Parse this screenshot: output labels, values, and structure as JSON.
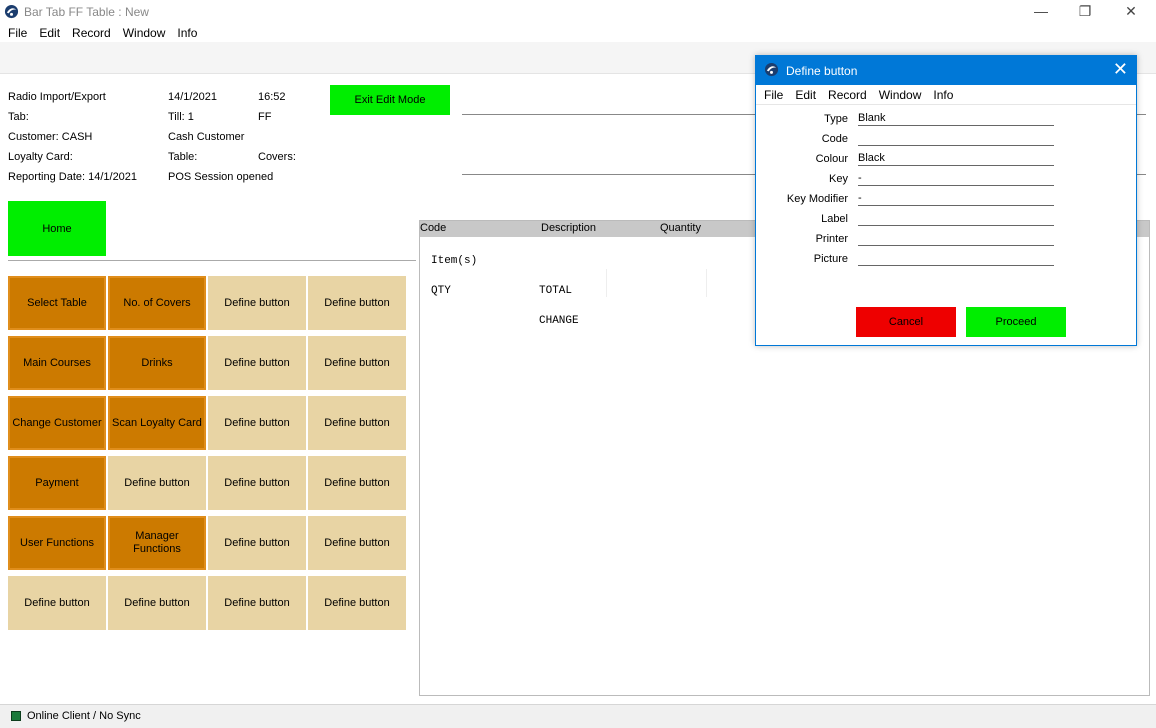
{
  "window": {
    "title": "Bar Tab FF Table : New"
  },
  "menu": [
    "File",
    "Edit",
    "Record",
    "Window",
    "Info"
  ],
  "info": {
    "radio_import": "Radio Import/Export",
    "date": "14/1/2021",
    "time": "16:52",
    "tab": "Tab:",
    "till": "Till: 1",
    "ff": "FF",
    "customer": "Customer: CASH",
    "customer_name": "Cash Customer",
    "loyalty_card": "Loyalty Card:",
    "table": "Table:",
    "covers": "Covers:",
    "reporting_date": "Reporting Date: 14/1/2021",
    "session": "POS Session opened"
  },
  "exit_edit_mode": "Exit Edit Mode",
  "home": "Home",
  "buttons": [
    [
      "Select Table",
      "No. of  Covers",
      "Define button",
      "Define button"
    ],
    [
      "Main Courses",
      "Drinks",
      "Define button",
      "Define button"
    ],
    [
      "Change Customer",
      "Scan Loyalty Card",
      "Define button",
      "Define button"
    ],
    [
      "Payment",
      "Define button",
      "Define button",
      "Define button"
    ],
    [
      "User Functions",
      "Manager Functions",
      "Define button",
      "Define button"
    ],
    [
      "Define button",
      "Define button",
      "Define button",
      "Define button"
    ]
  ],
  "items": {
    "headers": [
      "Code",
      "Description",
      "Quantity"
    ],
    "item_count_label": "Item(s)",
    "qty_label": "QTY",
    "total_label": "TOTAL",
    "change_label": "CHANGE"
  },
  "status": {
    "text": "Online Client / No Sync",
    "indicator_color": "#1a7a3a"
  },
  "dialog": {
    "title": "Define button",
    "menu": [
      "File",
      "Edit",
      "Record",
      "Window",
      "Info"
    ],
    "fields": [
      {
        "label": "Type",
        "value": "Blank"
      },
      {
        "label": "Code",
        "value": ""
      },
      {
        "label": "Colour",
        "value": "Black"
      },
      {
        "label": "Key",
        "value": "-"
      },
      {
        "label": "Key Modifier",
        "value": "-"
      },
      {
        "label": "Label",
        "value": ""
      },
      {
        "label": "Printer",
        "value": ""
      },
      {
        "label": "Picture",
        "value": ""
      }
    ],
    "cancel": "Cancel",
    "proceed": "Proceed",
    "cancel_color": "#ee0000",
    "proceed_color": "#00ee00"
  }
}
